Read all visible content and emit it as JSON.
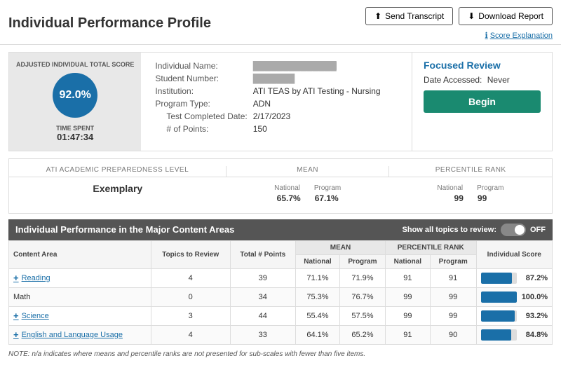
{
  "header": {
    "title": "Individual Performance Profile",
    "send_transcript_label": "Send Transcript",
    "download_report_label": "Download Report",
    "score_explanation_label": "Score Explanation"
  },
  "profile": {
    "score_label_top": "ADJUSTED INDIVIDUAL TOTAL SCORE",
    "score_value": "92.0%",
    "time_label": "TIME SPENT",
    "time_value": "01:47:34",
    "individual_name_label": "Individual Name:",
    "individual_name_value": "██████████████",
    "student_number_label": "Student Number:",
    "student_number_value": "███████",
    "institution_label": "Institution:",
    "institution_value": "ATI TEAS by ATI Testing - Nursing",
    "program_type_label": "Program Type:",
    "program_type_value": "ADN",
    "test_date_label": "Test Completed Date:",
    "test_date_value": "2/17/2023",
    "points_label": "# of Points:",
    "points_value": "150"
  },
  "focused_review": {
    "title": "Focused Review",
    "date_accessed_label": "Date Accessed:",
    "date_accessed_value": "Never",
    "begin_label": "Begin"
  },
  "ati_level": {
    "col1_header": "ATI ACADEMIC PREPAREDNESS LEVEL",
    "col2_header": "MEAN",
    "col3_header": "PERCENTILE RANK",
    "level_value": "Exemplary",
    "national_label": "National",
    "program_label": "Program",
    "mean_national": "65.7%",
    "mean_program": "67.1%",
    "rank_national": "99",
    "rank_program": "99"
  },
  "content_table": {
    "header": "Individual Performance in the Major Content Areas",
    "show_all_label": "Show all topics to review:",
    "toggle_state": "OFF",
    "col_content_area": "Content Area",
    "col_topics": "Topics to Review",
    "col_total_points": "Total # Points",
    "col_mean_national": "National",
    "col_mean_program": "Program",
    "col_percentile_national": "National",
    "col_percentile_program": "Program",
    "col_individual_score": "Individual Score",
    "mean_label": "MEAN",
    "percentile_label": "PERCENTILE RANK",
    "rows": [
      {
        "area": "Reading",
        "has_plus": true,
        "topics": "4",
        "total_points": "39",
        "mean_national": "71.1%",
        "mean_program": "71.9%",
        "pct_national": "91",
        "pct_program": "91",
        "individual_score": "87.2%",
        "bar_pct": 87.2
      },
      {
        "area": "Math",
        "has_plus": false,
        "topics": "0",
        "total_points": "34",
        "mean_national": "75.3%",
        "mean_program": "76.7%",
        "pct_national": "99",
        "pct_program": "99",
        "individual_score": "100.0%",
        "bar_pct": 100
      },
      {
        "area": "Science",
        "has_plus": true,
        "topics": "3",
        "total_points": "44",
        "mean_national": "55.4%",
        "mean_program": "57.5%",
        "pct_national": "99",
        "pct_program": "99",
        "individual_score": "93.2%",
        "bar_pct": 93.2
      },
      {
        "area": "English and Language Usage",
        "has_plus": true,
        "topics": "4",
        "total_points": "33",
        "mean_national": "64.1%",
        "mean_program": "65.2%",
        "pct_national": "91",
        "pct_program": "90",
        "individual_score": "84.8%",
        "bar_pct": 84.8
      }
    ]
  },
  "note": "NOTE: n/a indicates where means and percentile ranks are not presented for sub-scales with fewer than five items."
}
